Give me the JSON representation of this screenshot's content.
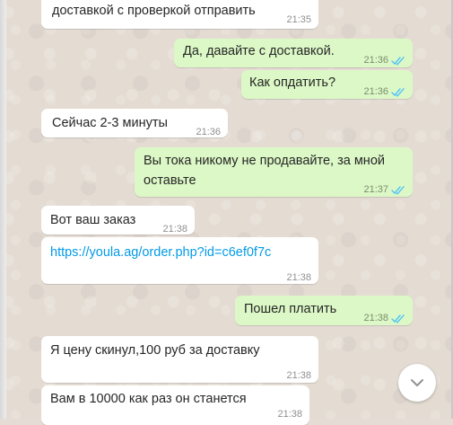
{
  "chat": {
    "messages": [
      {
        "direction": "in",
        "text": "доставкой с проверкой отправить",
        "time": "21:35"
      },
      {
        "direction": "out",
        "text": "Да, давайте с доставкой.",
        "time": "21:36",
        "status": "read"
      },
      {
        "direction": "out",
        "text": "Как опдатить?",
        "time": "21:36",
        "status": "read"
      },
      {
        "direction": "in",
        "text": "Сейчас 2-3 минуты",
        "time": "21:36"
      },
      {
        "direction": "out",
        "lines": [
          "Вы тока никому не продавайте, за мной",
          "оставьте"
        ],
        "time": "21:37",
        "status": "read"
      },
      {
        "direction": "in",
        "text": "Вот ваш заказ",
        "time": "21:38"
      },
      {
        "direction": "in",
        "text": "https://youla.ag/order.php?id=c6ef0f7c",
        "time": "21:38",
        "is_link": true
      },
      {
        "direction": "out",
        "text": "Пошел платить",
        "time": "21:38",
        "status": "read"
      },
      {
        "direction": "in",
        "text": "Я цену скинул,100 руб за доставку",
        "time": "21:38"
      },
      {
        "direction": "in",
        "text": "Вам в 10000 как раз он станется",
        "time": "21:38"
      }
    ]
  },
  "scroll_button": {
    "icon": "chevron-down-icon"
  },
  "colors": {
    "incoming": "#ffffff",
    "outgoing": "#dcf8c6",
    "read_ticks": "#4fc3f7",
    "link": "#039be5",
    "wallpaper": "#e5ddd5"
  }
}
